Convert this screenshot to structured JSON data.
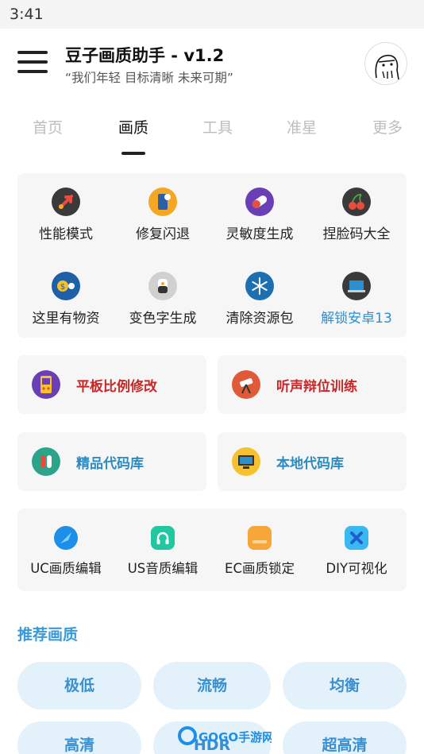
{
  "status_bar": {
    "time": "3:41"
  },
  "header": {
    "title": "豆子画质助手 - v1.2",
    "subtitle": "“我们年轻 目标清晰 未来可期”"
  },
  "tabs": [
    {
      "label": "首页"
    },
    {
      "label": "画质"
    },
    {
      "label": "工具"
    },
    {
      "label": "准星"
    },
    {
      "label": "更多"
    }
  ],
  "features": [
    {
      "label": "性能模式",
      "icon": "rocket-icon",
      "color": "#3a3a3a"
    },
    {
      "label": "修复闪退",
      "icon": "phone-icon",
      "color": "#f5a623"
    },
    {
      "label": "灵敏度生成",
      "icon": "pill-icon",
      "color": "#6a3fb5"
    },
    {
      "label": "捏脸码大全",
      "icon": "cherry-icon",
      "color": "#3a3a3a"
    },
    {
      "label": "这里有物资",
      "icon": "money-icon",
      "color": "#1f5fa8"
    },
    {
      "label": "变色字生成",
      "icon": "cup-icon",
      "color": "#d0d0d0"
    },
    {
      "label": "清除资源包",
      "icon": "snowflake-icon",
      "color": "#1e6fb0"
    },
    {
      "label": "解锁安卓13",
      "icon": "laptop-icon",
      "color": "#3a3a3a"
    }
  ],
  "wide_buttons": [
    {
      "label": "平板比例修改",
      "icon": "gameboy-icon",
      "color": "#6a3fb5"
    },
    {
      "label": "听声辩位训练",
      "icon": "telescope-icon",
      "color": "#e05a3a"
    },
    {
      "label": "精品代码库",
      "icon": "chip-icon",
      "color": "#2aa58a"
    },
    {
      "label": "本地代码库",
      "icon": "computer-icon",
      "color": "#f5c12e"
    }
  ],
  "editors": [
    {
      "label": "UC画质编辑",
      "icon": "compass-icon",
      "color": "#1e8fe8"
    },
    {
      "label": "US音质编辑",
      "icon": "headphone-icon",
      "color": "#1fc8a0"
    },
    {
      "label": "EC画质锁定",
      "icon": "card-icon",
      "color": "#f7a63a"
    },
    {
      "label": "DIY可视化",
      "icon": "diamond-icon",
      "color": "#3ab8f0"
    }
  ],
  "section_title": "推荐画质",
  "quality_presets": [
    {
      "label": "极低"
    },
    {
      "label": "流畅"
    },
    {
      "label": "均衡"
    },
    {
      "label": "高清"
    },
    {
      "label": "HDR"
    },
    {
      "label": "超高清"
    }
  ],
  "watermark": {
    "text": "GOGO手游网"
  }
}
